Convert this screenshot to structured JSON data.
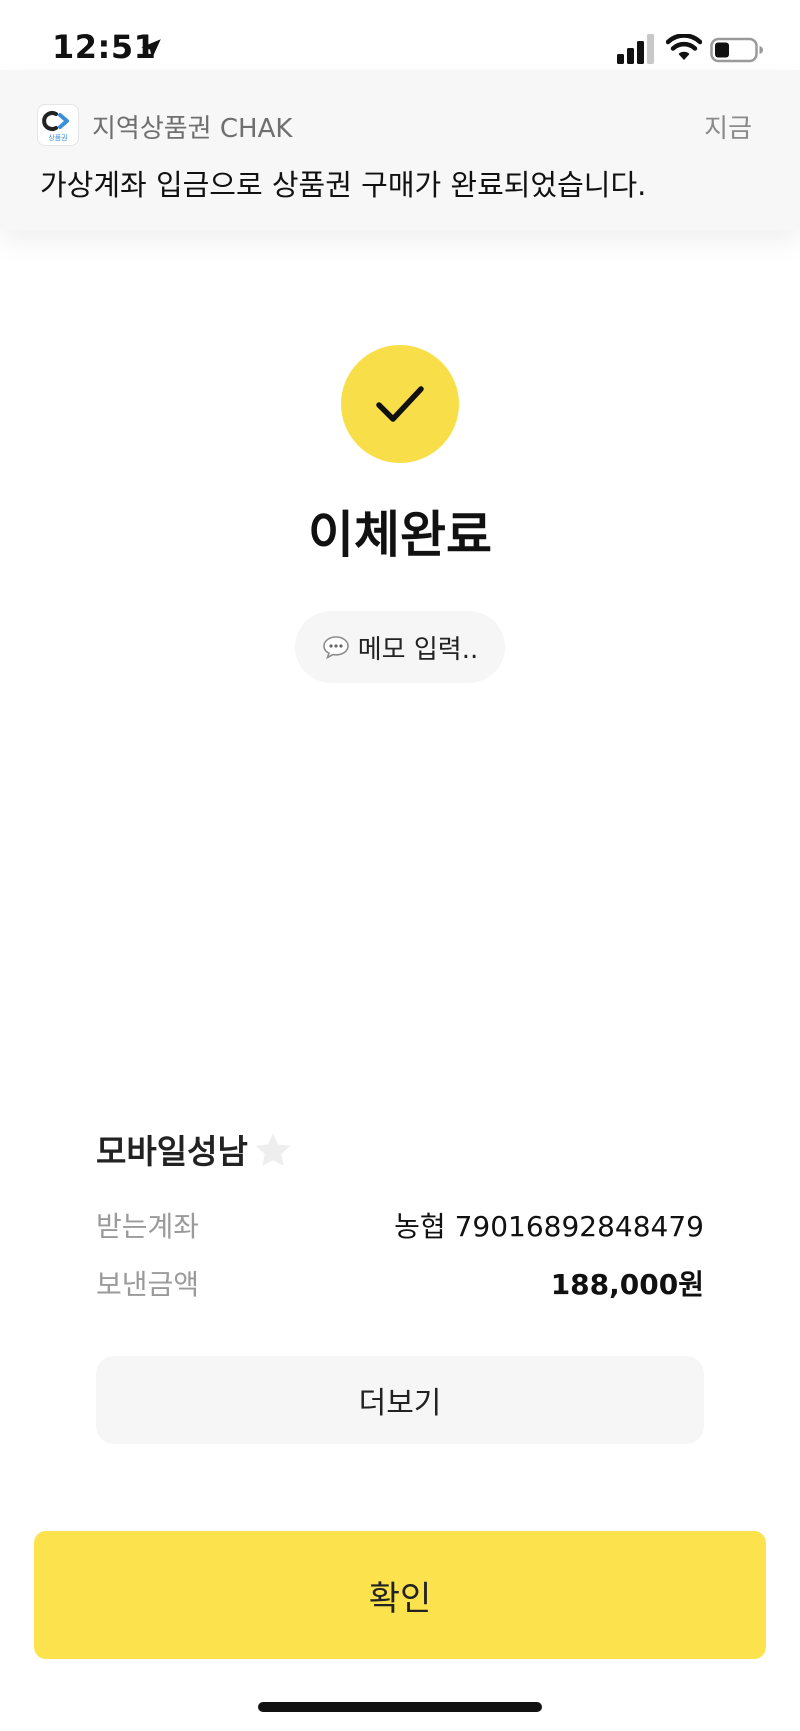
{
  "status_bar": {
    "time": "12:51",
    "location_icon": "location-arrow-icon",
    "signal_icon": "cellular-signal-icon",
    "wifi_icon": "wifi-icon",
    "battery_icon": "battery-icon",
    "battery_level": 0.35
  },
  "notification": {
    "app_icon": "chak-app-icon",
    "app_icon_text": "상품권",
    "app_name": "지역상품권 CHAK",
    "time": "지금",
    "message": "가상계좌 입금으로 상품권 구매가 완료되었습니다."
  },
  "success": {
    "icon": "checkmark-icon",
    "color": "#f8df4a",
    "title": "이체완료"
  },
  "memo": {
    "icon": "speech-bubble-icon",
    "label": "메모 입력.."
  },
  "transfer": {
    "recipient": "모바일성남",
    "favorite_icon": "star-icon",
    "favorited": false,
    "account_label": "받는계좌",
    "account_value": "농협 79016892848479",
    "amount_label": "보낸금액",
    "amount_value": "188,000원"
  },
  "buttons": {
    "more": "더보기",
    "confirm": "확인",
    "confirm_color": "#fce34d"
  }
}
